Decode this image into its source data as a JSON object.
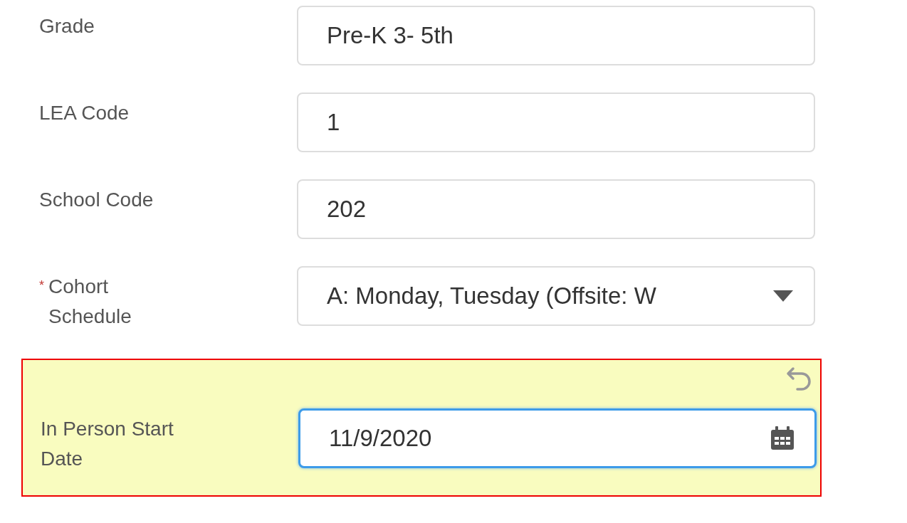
{
  "fields": [
    {
      "kind": "text",
      "label": "Grade",
      "required": false,
      "value": "Pre-K 3- 5th",
      "changed": false,
      "focused": false
    },
    {
      "kind": "text",
      "label": "LEA Code",
      "required": false,
      "value": "1",
      "changed": false,
      "focused": false
    },
    {
      "kind": "text",
      "label": "School Code",
      "required": false,
      "value": "202",
      "changed": false,
      "focused": false
    },
    {
      "kind": "select",
      "label": "Cohort Schedule",
      "required": true,
      "required_mark": "*",
      "value": "A: Monday, Tuesday (Offsite: W",
      "changed": false,
      "focused": false
    },
    {
      "kind": "date",
      "label": "In Person Start Date",
      "required": false,
      "value": "11/9/2020",
      "changed": true,
      "focused": true
    }
  ]
}
